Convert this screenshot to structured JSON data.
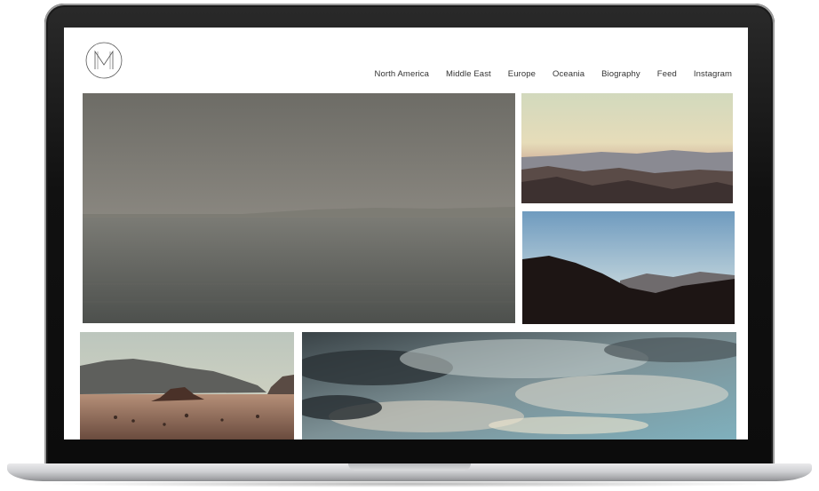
{
  "site": {
    "logo_icon": "monogram-m-circle-icon"
  },
  "nav": {
    "items": [
      {
        "label": "North America"
      },
      {
        "label": "Middle East"
      },
      {
        "label": "Europe"
      },
      {
        "label": "Oceania"
      },
      {
        "label": "Biography"
      },
      {
        "label": "Feed"
      },
      {
        "label": "Instagram"
      }
    ]
  },
  "gallery": {
    "photos": [
      {
        "subject": "hazy-sea-photo"
      },
      {
        "subject": "desert-mountains-dusk-photo"
      },
      {
        "subject": "mountain-silhouette-photo"
      },
      {
        "subject": "desert-rocks-photo"
      },
      {
        "subject": "cloudy-sky-photo"
      }
    ]
  },
  "colors": {
    "bezel": "#111111",
    "aluminum": "#cfd0d3",
    "nav_text": "#333333"
  }
}
